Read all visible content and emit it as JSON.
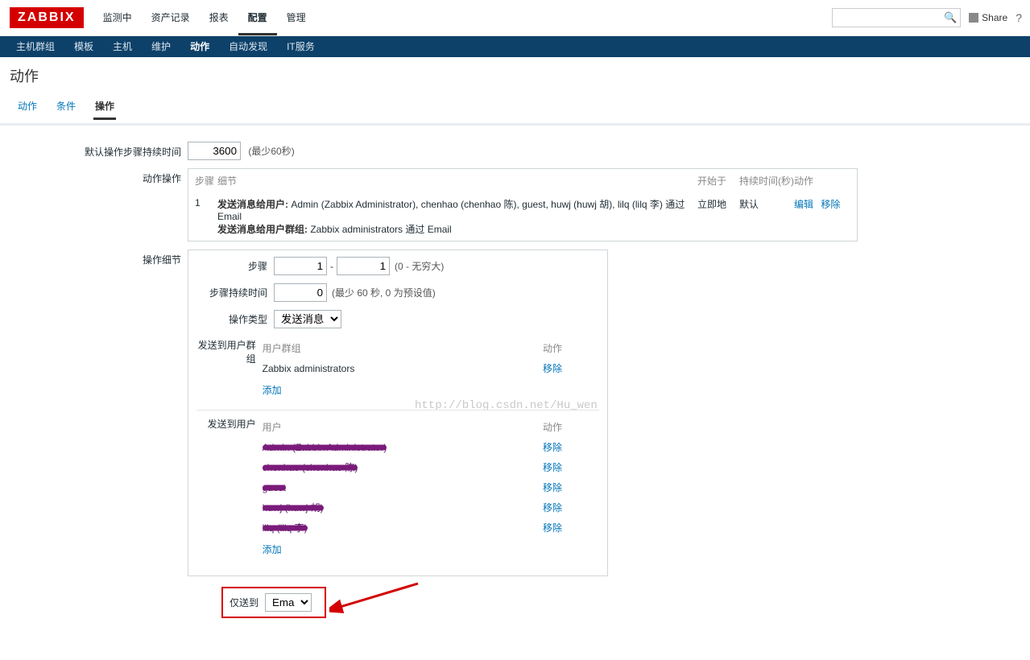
{
  "logo": "ZABBIX",
  "topMenu": {
    "items": [
      "监测中",
      "资产记录",
      "报表",
      "配置",
      "管理"
    ],
    "activeIndex": 3
  },
  "topRight": {
    "share": "Share",
    "help": "?"
  },
  "subMenu": {
    "items": [
      "主机群组",
      "模板",
      "主机",
      "维护",
      "动作",
      "自动发现",
      "IT服务"
    ],
    "activeIndex": 4
  },
  "pageTitle": "动作",
  "tabs": {
    "items": [
      "动作",
      "条件",
      "操作"
    ],
    "activeIndex": 2
  },
  "form": {
    "defaultDurationLabel": "默认操作步骤持续时间",
    "defaultDurationValue": "3600",
    "defaultDurationHint": "(最少60秒)",
    "actionOpsLabel": "动作操作",
    "opsHeader": {
      "step": "步骤",
      "detail": "细节",
      "start": "开始于",
      "duration": "持续时间(秒)",
      "action": "动作"
    },
    "opsRow": {
      "step": "1",
      "line1Label": "发送消息给用户:",
      "line1Text": " Admin (Zabbix Administrator), chenhao (chenhao 陈), guest, huwj (huwj 胡), lilq (lilq 李) 通过 Email",
      "line2Label": "发送消息给用户群组:",
      "line2Text": " Zabbix administrators 通过 Email",
      "start": "立即地",
      "duration": "默认",
      "edit": "编辑",
      "remove": "移除"
    },
    "detailLabel": "操作细节",
    "detail": {
      "stepLabel": "步骤",
      "stepFrom": "1",
      "stepSep": "-",
      "stepTo": "1",
      "stepHint": "(0 - 无穷大)",
      "durLabel": "步骤持续时间",
      "durVal": "0",
      "durHint": "(最少 60 秒, 0 为预设值)",
      "typeLabel": "操作类型",
      "typeVal": "发送消息",
      "sendGroupsLabel": "发送到用户群组",
      "groupsHeader": {
        "c1": "用户群组",
        "c2": "动作"
      },
      "groups": [
        {
          "name": "Zabbix administrators",
          "remove": "移除"
        }
      ],
      "groupsAdd": "添加",
      "sendUsersLabel": "发送到用户",
      "usersHeader": {
        "c1": "用户",
        "c2": "动作"
      },
      "users": [
        {
          "name": "Admin (Zabbix Administrator)",
          "remove": "移除"
        },
        {
          "name": "chenhao (chenhao 陈)",
          "remove": "移除"
        },
        {
          "name": "guest",
          "remove": "移除"
        },
        {
          "name": "huwj (huwj 胡)",
          "remove": "移除"
        },
        {
          "name": "lilq (lilq 李)",
          "remove": "移除"
        }
      ],
      "usersAdd": "添加",
      "onlySendLabel": "仅送到",
      "onlySendValue": "Email"
    }
  },
  "watermark": "http://blog.csdn.net/Hu_wen"
}
